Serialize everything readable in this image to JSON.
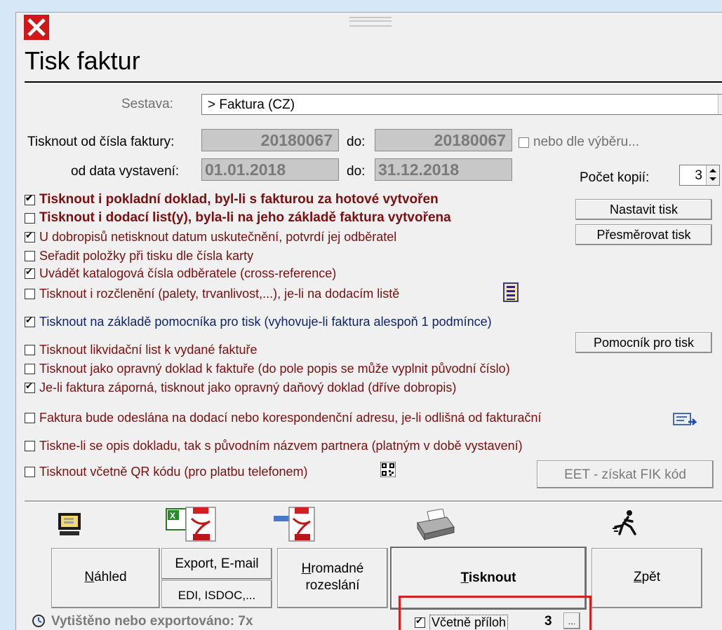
{
  "window": {
    "title": "Tisk faktur"
  },
  "report": {
    "label": "Sestava:",
    "value": "> Faktura (CZ)"
  },
  "range": {
    "from_label": "Tisknout od čísla faktury:",
    "from_value": "20180067",
    "to_label": "do:",
    "to_value": "20180067",
    "selection_label": "nebo dle výběru...",
    "date_from_label": "od data vystavení:",
    "date_from_value": "01.01.2018",
    "date_to_label": "do:",
    "date_to_value": "31.12.2018"
  },
  "copies": {
    "label": "Počet kopií:",
    "value": "3"
  },
  "options": [
    {
      "label": "Tisknout i pokladní doklad, byl-li s fakturou za hotové vytvořen",
      "checked": true
    },
    {
      "label": "Tisknout i dodací list(y), byla-li na jeho základě faktura vytvořena",
      "checked": false
    },
    {
      "label": "U dobropisů netisknout datum uskutečnění, potvrdí jej odběratel",
      "checked": true
    },
    {
      "label": "Seřadit položky při tisku dle čísla karty",
      "checked": false
    },
    {
      "label": "Uvádět katalogová čísla odběratele (cross-reference)",
      "checked": true
    },
    {
      "label": "Tisknout i rozčlenění (palety, trvanlivost,...), je-li na dodacím listě",
      "checked": false
    },
    {
      "label": "Tisknout na základě pomocníka pro tisk (vyhovuje-li faktura alespoň 1 podmínce)",
      "checked": true
    },
    {
      "label": "Tisknout likvidační list k vydané faktuře",
      "checked": false
    },
    {
      "label": "Tisknout jako opravný doklad k faktuře (do pole popis se může vyplnit původní číslo)",
      "checked": false
    },
    {
      "label": "Je-li faktura záporná, tisknout jako opravný daňový doklad (dříve dobropis)",
      "checked": true
    },
    {
      "label": "Faktura bude odeslána na dodací nebo korespondenční adresu, je-li odlišná od fakturační",
      "checked": false
    },
    {
      "label": "Tiskne-li se opis dokladu, tak s původním názvem partnera (platným v době vystavení)",
      "checked": false
    },
    {
      "label": "Tisknout včetně QR kódu (pro platbu telefonem)",
      "checked": false
    }
  ],
  "side_buttons": {
    "print_setup": "Nastavit tisk",
    "redirect": "Přesměrovat tisk",
    "helper": "Pomocník pro tisk",
    "eet": "EET - získat FIK kód"
  },
  "actions": {
    "preview_pre": "N",
    "preview_post": "áhled",
    "export": "Export, E-mail",
    "edi": "EDI, ISDOC,...",
    "bulk_pre": "H",
    "bulk_post": "romadné",
    "bulk_line2": "rozeslání",
    "print_pre": "T",
    "print_post": "isknout",
    "back_pre": "Z",
    "back_post": "pět"
  },
  "status": {
    "printed": "Vytištěno nebo exportováno: 7x",
    "attachments_label": "Včetně příloh",
    "attachments_checked": true,
    "attachments_count": "3",
    "more": "..."
  }
}
